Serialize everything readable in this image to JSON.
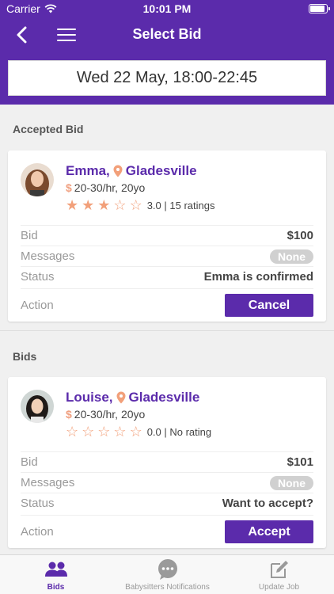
{
  "status_bar": {
    "carrier": "Carrier",
    "time": "10:01 PM"
  },
  "nav": {
    "title": "Select Bid"
  },
  "date": "Wed 22 May, 18:00-22:45",
  "accepted_section": {
    "label": "Accepted Bid"
  },
  "bids_section": {
    "label": "Bids"
  },
  "accepted_bid": {
    "name": "Emma,",
    "location": "Gladesville",
    "rate": "20-30/hr, 20yo",
    "rating_text": "3.0 | 15 ratings",
    "rating": 3,
    "bid_label": "Bid",
    "bid_value": "$100",
    "messages_label": "Messages",
    "messages_value": "None",
    "status_label": "Status",
    "status_value": "Emma is confirmed",
    "action_label": "Action",
    "action_button": "Cancel"
  },
  "bid": {
    "name": "Louise,",
    "location": "Gladesville",
    "rate": "20-30/hr, 20yo",
    "rating_text": "0.0 | No rating",
    "rating": 0,
    "bid_label": "Bid",
    "bid_value": "$101",
    "messages_label": "Messages",
    "messages_value": "None",
    "status_label": "Status",
    "status_value": "Want to accept?",
    "action_label": "Action",
    "action_button": "Accept"
  },
  "tabs": [
    {
      "label": "Bids",
      "icon": "people-icon",
      "active": true
    },
    {
      "label": "Babysitters Notifications",
      "icon": "chat-bubble-icon",
      "active": false
    },
    {
      "label": "Update Job",
      "icon": "edit-icon",
      "active": false
    }
  ],
  "colors": {
    "primary": "#5b2bab",
    "star": "#f2a07a",
    "pill": "#d0d0d0"
  }
}
